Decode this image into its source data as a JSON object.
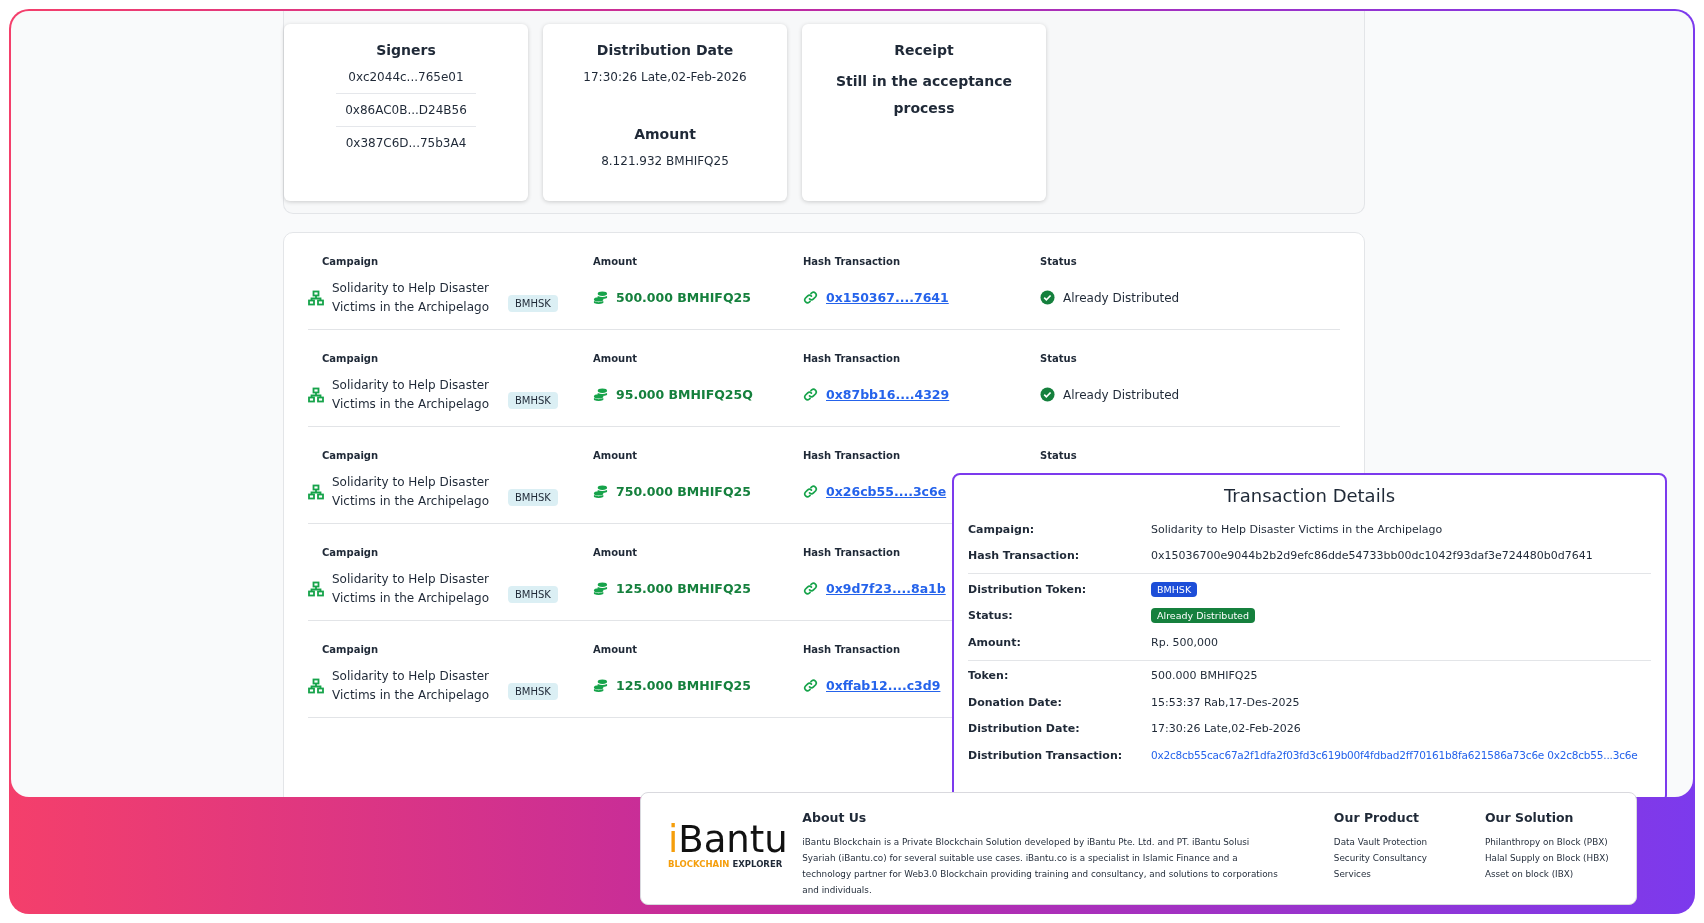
{
  "summary": {
    "signers": {
      "title": "Signers",
      "addresses": [
        "0xc2044c...765e01",
        "0x86AC0B...D24B56",
        "0x387C6D...75b3A4"
      ]
    },
    "distribution": {
      "title": "Distribution Date",
      "date": "17:30:26 Late,02-Feb-2026",
      "amount_title": "Amount",
      "amount": "8.121.932 BMHIFQ25"
    },
    "receipt": {
      "title": "Receipt",
      "status": "Still in the acceptance process"
    }
  },
  "distributions": [
    {
      "campaign_label": "Campaign",
      "campaign": "Solidarity to Help Disaster Victims in the Archipelago",
      "token": "BMHSK",
      "amount_label": "Amount",
      "amount": "500.000 BMHIFQ25",
      "hash_label": "Hash Transaction",
      "hash": "0x150367....7641",
      "status_label": "Status",
      "status": "Already Distributed"
    },
    {
      "campaign_label": "Campaign",
      "campaign": "Solidarity to Help Disaster Victims in the Archipelago",
      "token": "BMHSK",
      "amount_label": "Amount",
      "amount": "95.000 BMHIFQ25Q",
      "hash_label": "Hash Transaction",
      "hash": "0x87bb16....4329",
      "status_label": "Status",
      "status": "Already Distributed"
    },
    {
      "campaign_label": "Campaign",
      "campaign": "Solidarity to Help Disaster Victims in the Archipelago",
      "token": "BMHSK",
      "amount_label": "Amount",
      "amount": "750.000 BMHIFQ25",
      "hash_label": "Hash Transaction",
      "hash": "0x26cb55....3c6e",
      "status_label": "Status"
    },
    {
      "campaign_label": "Campaign",
      "campaign": "Solidarity to Help Disaster Victims in the Archipelago",
      "token": "BMHSK",
      "amount_label": "Amount",
      "amount": "125.000 BMHIFQ25",
      "hash_label": "Hash Transaction",
      "hash": "0x9d7f23....8a1b"
    },
    {
      "campaign_label": "Campaign",
      "campaign": "Solidarity to Help Disaster Victims in the Archipelago",
      "token": "BMHSK",
      "amount_label": "Amount",
      "amount": "125.000 BMHIFQ25",
      "hash_label": "Hash Transaction",
      "hash": "0xffab12....c3d9"
    }
  ],
  "transaction_details": {
    "title": "Transaction Details",
    "groups": [
      [
        {
          "label": "Campaign:",
          "value": "Solidarity to Help Disaster Victims in the Archipelago",
          "kind": "text"
        },
        {
          "label": "Hash Transaction:",
          "value": "0x15036700e9044b2b2d9efc86dde54733bb00dc1042f93daf3e724480b0d7641",
          "kind": "text"
        }
      ],
      [
        {
          "label": "Distribution Token:",
          "value": "BMHSK",
          "kind": "token"
        },
        {
          "label": "Status:",
          "value": "Already Distributed",
          "kind": "status"
        },
        {
          "label": "Amount:",
          "value": "Rp. 500,000",
          "kind": "text"
        }
      ],
      [
        {
          "label": "Token:",
          "value": "500.000 BMHIFQ25",
          "kind": "text"
        },
        {
          "label": "Donation Date:",
          "value": "15:53:37 Rab,17-Des-2025",
          "kind": "text"
        },
        {
          "label": "Distribution Date:",
          "value": "17:30:26 Late,02-Feb-2026",
          "kind": "text"
        },
        {
          "label": "Distribution Transaction:",
          "value": "0x2c8cb55cac67a2f1dfa2f03fd3c619b00f4fdbad2ff70161b8fa621586a73c6e 0x2c8cb55...3c6e",
          "kind": "link"
        }
      ]
    ]
  },
  "footer": {
    "logo": {
      "initial": "i",
      "name": "Bantu",
      "tagline_accent": "BLOCKCHAIN",
      "tagline": "EXPLORER"
    },
    "about": {
      "title": "About Us",
      "text": "iBantu Blockchain is a Private Blockchain Solution developed by iBantu Pte. Ltd. and PT. iBantu Solusi Syariah (iBantu.co) for several suitable use cases. iBantu.co is a specialist in Islamic Finance and a technology partner for Web3.0 Blockchain providing training and consultancy, and solutions to corporations and individuals."
    },
    "product": {
      "title": "Our Product",
      "links": [
        "Data Vault Protection",
        "Security Consultancy",
        "Services"
      ]
    },
    "solution": {
      "title": "Our Solution",
      "links": [
        "Philanthropy on Block (PBX)",
        "Halal Supply on Block (HBX)",
        "Asset on block (IBX)"
      ]
    }
  }
}
